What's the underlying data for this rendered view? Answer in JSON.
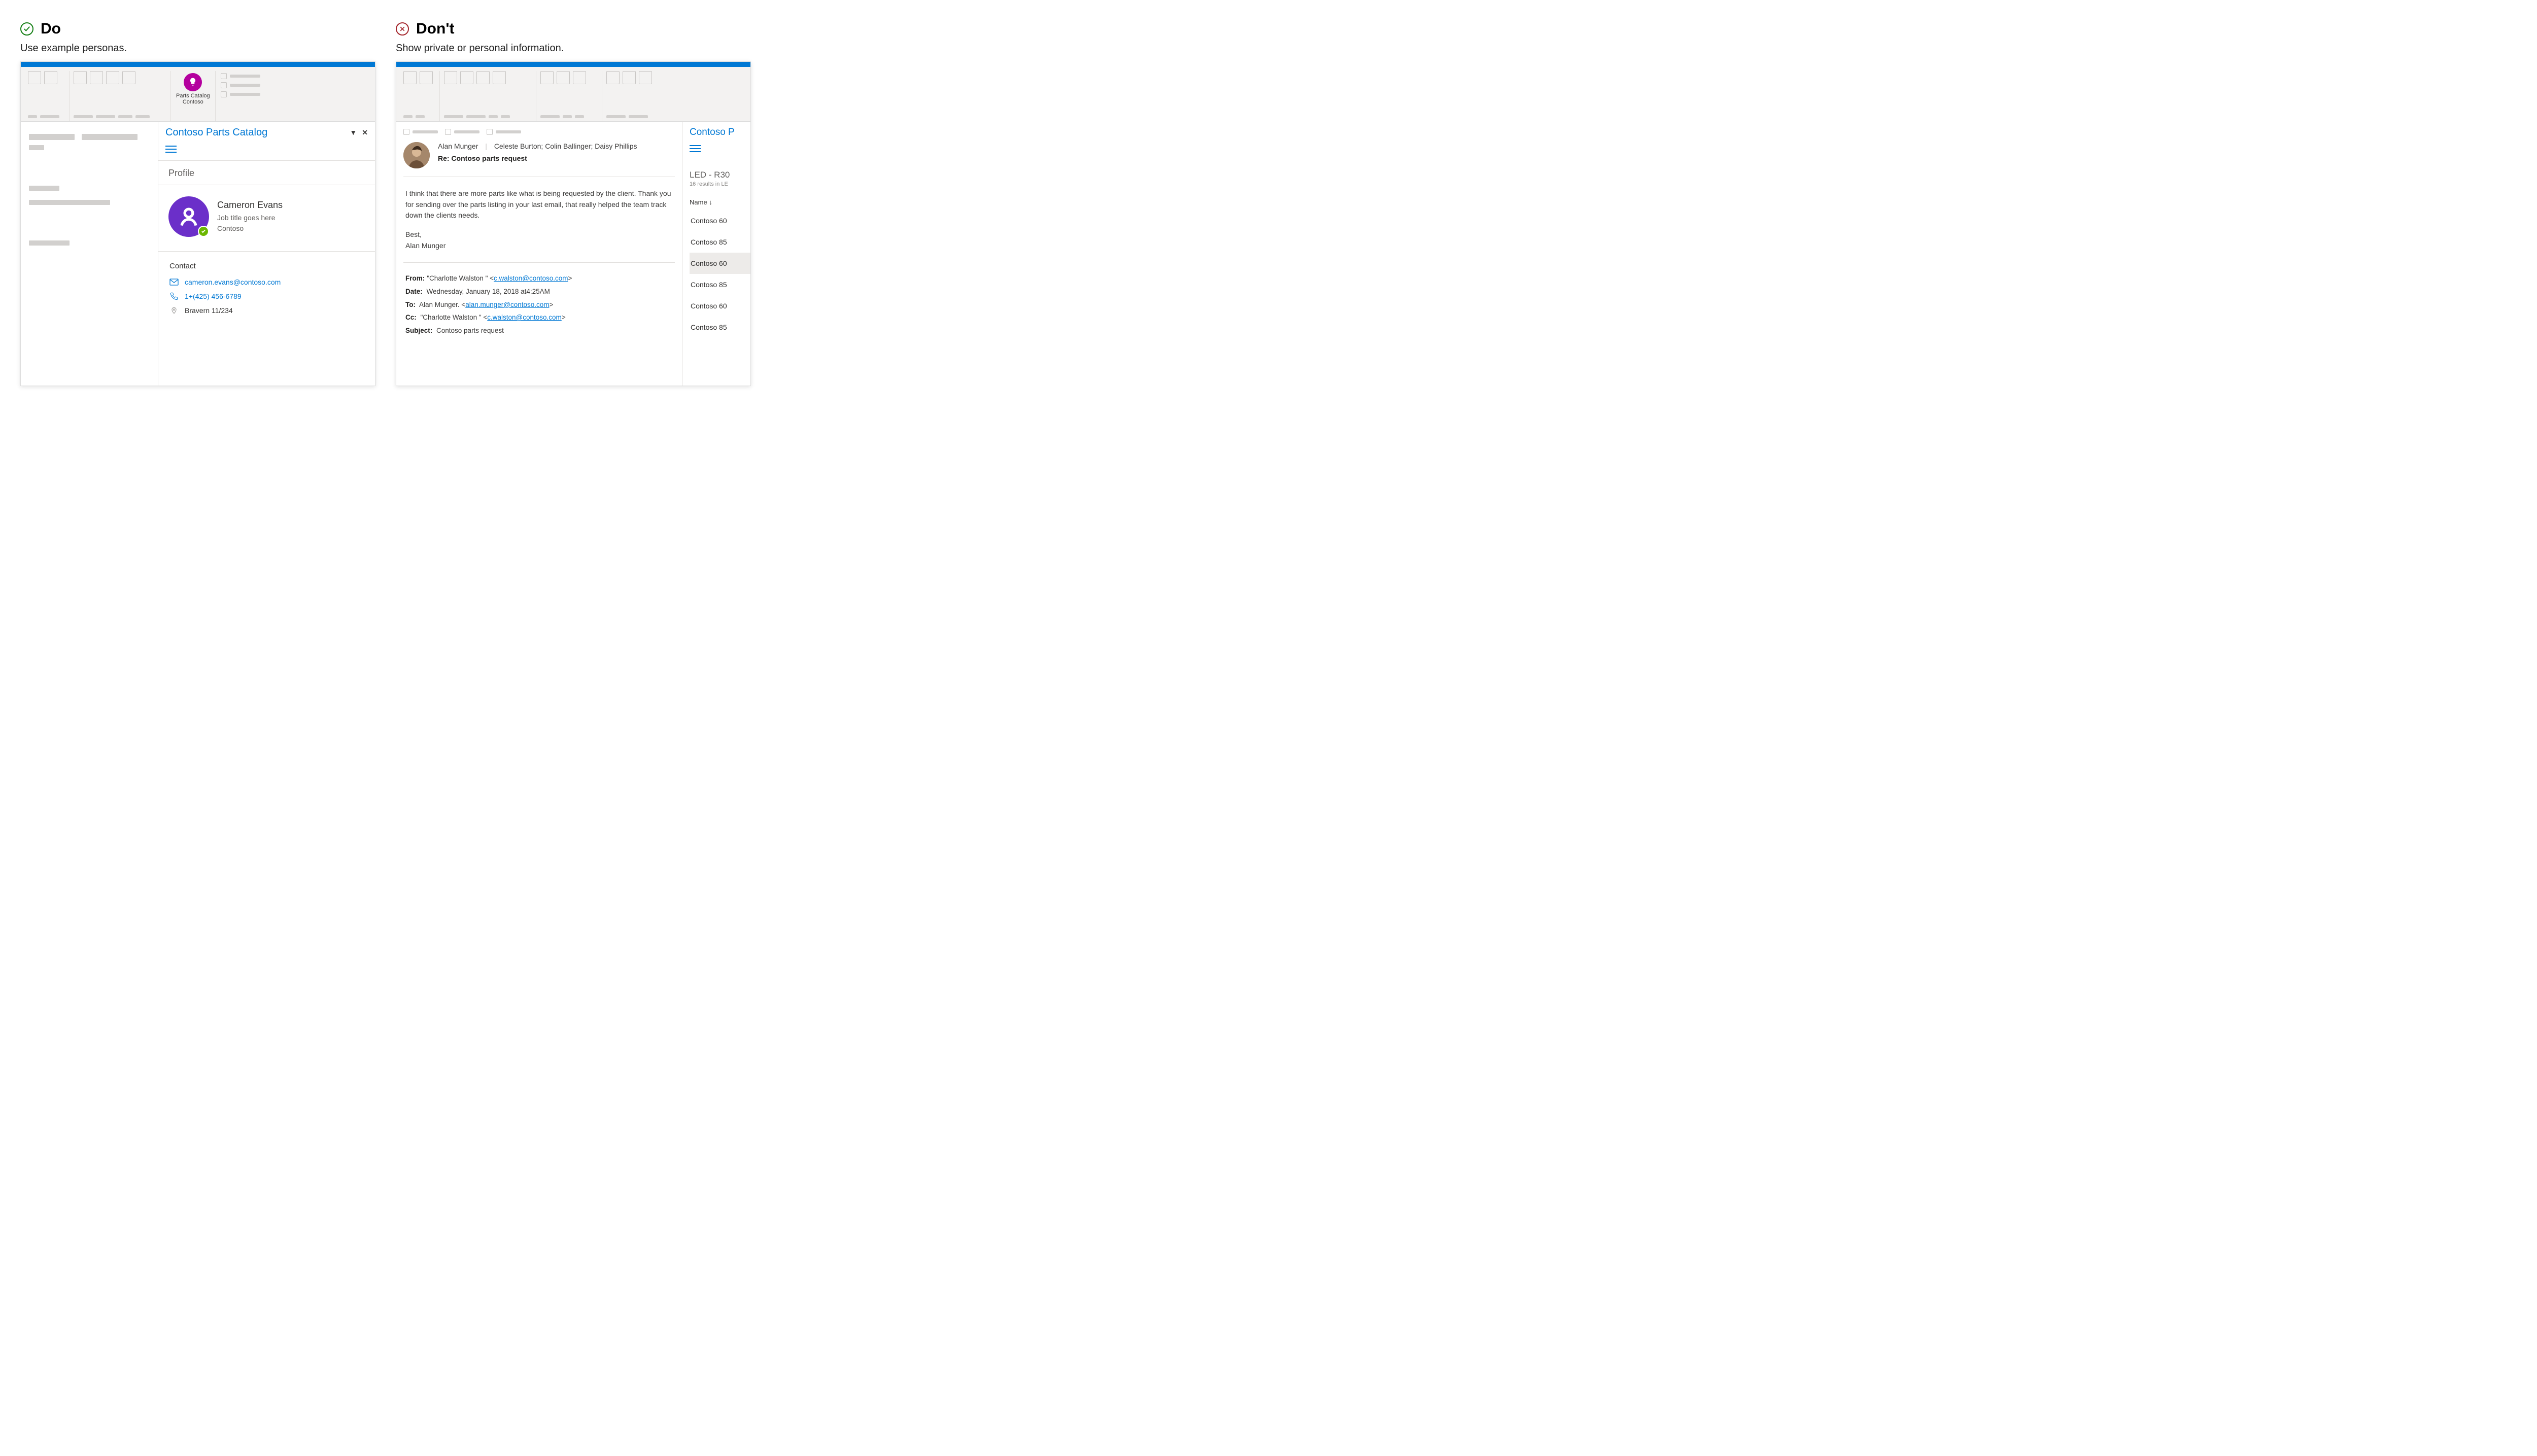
{
  "do": {
    "heading": "Do",
    "subtitle": "Use example personas.",
    "addin": {
      "label_line1": "Parts Catalog",
      "label_line2": "Contoso"
    },
    "taskpane": {
      "title": "Contoso Parts Catalog",
      "section_profile": "Profile",
      "profile": {
        "name": "Cameron Evans",
        "job": "Job title goes here",
        "company": "Contoso"
      },
      "section_contact": "Contact",
      "contact": {
        "email": "cameron.evans@contoso.com",
        "phone": "1+(425) 456-6789",
        "office": "Bravern 11/234"
      }
    }
  },
  "dont": {
    "heading": "Don't",
    "subtitle": "Show private or personal information.",
    "message": {
      "from": "Alan Munger",
      "to_line": "Celeste Burton; Colin Ballinger; Daisy Phillips",
      "subject": "Re: Contoso parts request",
      "body_p1": "I think that there are more parts like what is being requested by the client. Thank you for sending over the parts listing in your last email, that really helped the team track down the clients needs.",
      "body_sign1": "Best,",
      "body_sign2": "Alan Munger",
      "fields": {
        "from_label": "From:",
        "from_name": "\"Charlotte Walston \" <",
        "from_email": "c.walston@contoso.com",
        "from_close": ">",
        "date_label": "Date:",
        "date_value": "  Wednesday, January 18, 2018 at4:25AM",
        "to_label": "To:",
        "to_name": "  Alan Munger. <",
        "to_email": "alan.munger@contoso.com",
        "to_close": ">",
        "cc_label": "Cc:",
        "cc_name": "  \"Charlotte Walston \" <",
        "cc_email": "c.walston@contoso.com",
        "cc_close": ">",
        "subj_label": "Subject:",
        "subj_value": " Contoso parts request"
      }
    },
    "sidepane": {
      "title": "Contoso P",
      "search_term": "LED - R30",
      "results_hint": "16 results in LE",
      "col_name": "Name  ↓",
      "rows": [
        "Contoso 60",
        "Contoso 85",
        "Contoso 60",
        "Contoso 85",
        "Contoso 60",
        "Contoso 85"
      ]
    }
  }
}
